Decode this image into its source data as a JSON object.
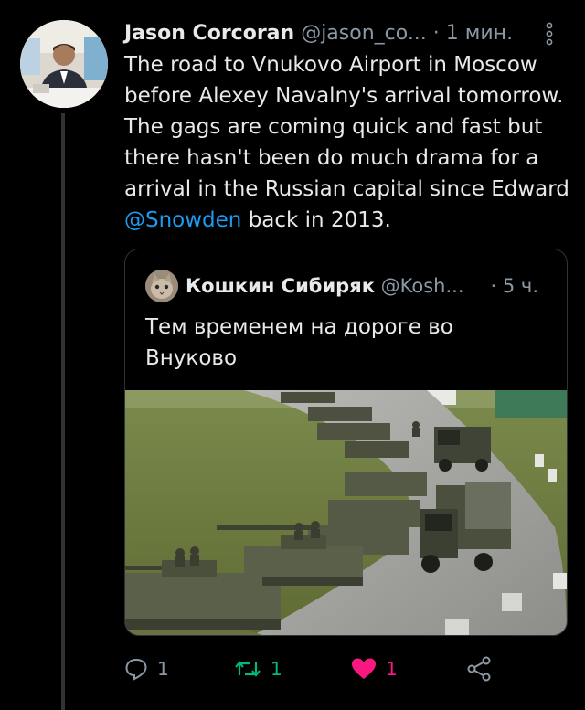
{
  "tweet": {
    "author": {
      "name": "Jason Corcoran",
      "handle": "@jason_co...",
      "separator": "·",
      "time": "1 мин."
    },
    "text_parts": {
      "before_mention": "The road to Vnukovo Airport in Moscow before Alexey Navalny's arrival tomorrow. The gags are coming quick and fast but there hasn't been do much drama for a arrival in the Russian capital since Edward ",
      "mention": "@Snowden",
      "after_mention": " back in 2013."
    }
  },
  "quote": {
    "author": {
      "name": "Кошкин Сибиряк",
      "handle": "@Kosh...",
      "separator": "·",
      "time": "5 ч."
    },
    "text": "Тем временем на дороге во Внуково",
    "photo": "military convoy of tanks and trucks on a road"
  },
  "actions": {
    "reply_count": "1",
    "retweet_count": "1",
    "like_count": "1"
  },
  "colors": {
    "background": "#000000",
    "text": "#e7e9ea",
    "secondary": "#8b98a5",
    "mention": "#1d9bf0",
    "retweet": "#00ba7c",
    "like": "#f91880"
  },
  "icons": [
    "more-options-icon",
    "reply-icon",
    "retweet-icon",
    "like-icon",
    "share-icon"
  ]
}
